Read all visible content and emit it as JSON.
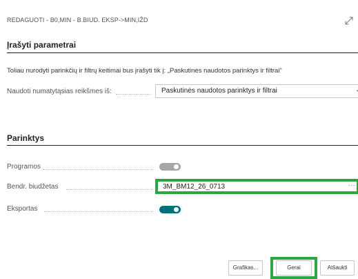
{
  "dialog": {
    "title": "REDAGUOTI - B0,MIN - B.BIUD. EKSP->MIN,IŽD"
  },
  "saved_parameters": {
    "heading": "Įrašyti parametrai",
    "info_text": "Toliau nurodyti parinkčių ir filtrų keitimai bus įrašyti tik į: „Paskutinės naudotos parinktys ir filtrai“",
    "defaults_label": "Naudoti numatytąsias reikšmes iš:",
    "defaults_value": "Paskutinės naudotos parinktys ir filtrai"
  },
  "options": {
    "heading": "Parinktys",
    "programs_label": "Programos",
    "programs_enabled": false,
    "budget_label": "Bendr. biudžetas",
    "budget_value": "3M_BM12_26_0713",
    "budget_more": "···",
    "export_label": "Eksportas",
    "export_enabled": true
  },
  "buttons": {
    "schedule_label": "Grafikas...",
    "ok_label": "Gerai",
    "cancel_label": "Atšaukti"
  },
  "colors": {
    "toggle_on": "#00707a",
    "toggle_off": "#a6a6a6",
    "highlight": "#2aa745"
  },
  "icons": {
    "expand": "expand-diagonal-icon",
    "chevron": "chevron-down-icon"
  }
}
